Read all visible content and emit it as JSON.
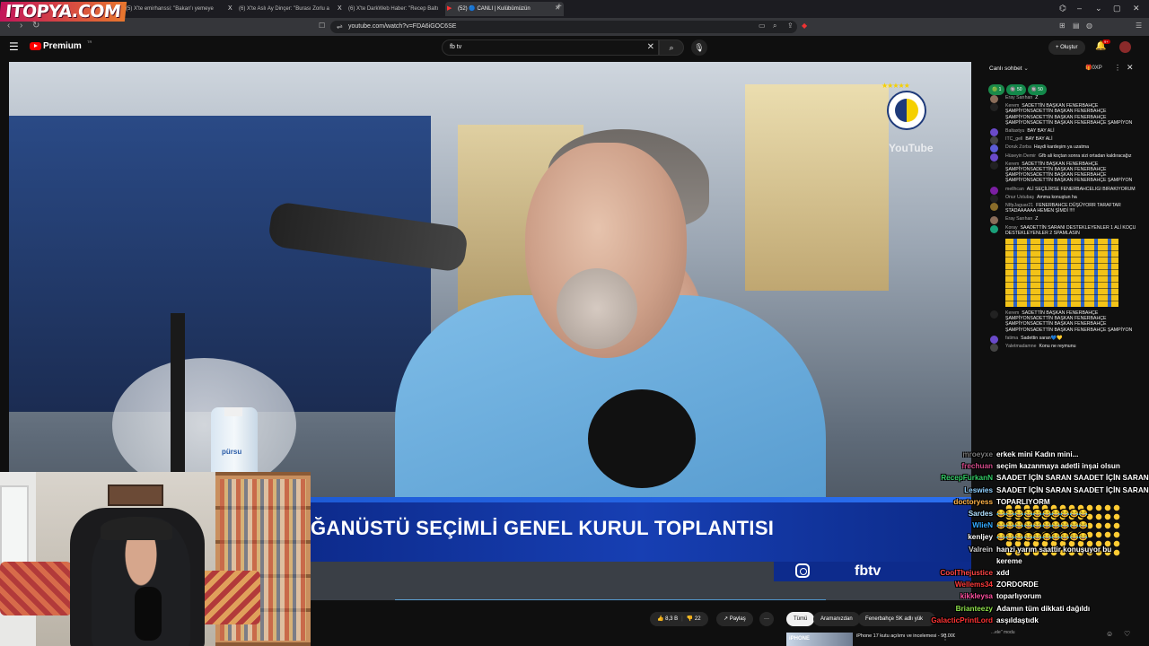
{
  "overlay_logo": "ITOPYA.COM",
  "tabs": [
    {
      "icon": "X",
      "label": "(5) X'te emirhanssi: \"Bakan'ı yemeye",
      "active": false
    },
    {
      "icon": "X",
      "label": "(6) X'te Aslı Ay Dinçer: \"Burası Zorlu a",
      "active": false
    },
    {
      "icon": "X",
      "label": "(6) X'te DarkWeb Haber: \"Recep Baltı",
      "active": false
    },
    {
      "icon": "▶",
      "label": "(52) 🔵 CANLI | Kulübümüzün",
      "active": true
    }
  ],
  "address": {
    "url": "youtube.com/watch?v=FDA6iGOC6SE"
  },
  "youtube": {
    "logo_text": "Premium",
    "logo_tm": "TR",
    "search_value": "fb tv",
    "create_label": "Oluştur",
    "notif_count": "9+"
  },
  "video": {
    "banner_text": "ĞANÜSTÜ SEÇİMLİ GENEL KURUL TOPLANTISI",
    "channel_brand": "fbtv",
    "watermark": "YouTube",
    "bottle_label": "pürsu"
  },
  "actions": {
    "likes": "8,3 B",
    "dislike_count": "22",
    "share": "Paylaş",
    "chips": [
      "Tümü",
      "Aramanızdan",
      "Fenerbahçe SK adlı yük"
    ],
    "reco_title": "iPhone 17 kutu açılımı ve incelemesi - 90.000 TL'ye değer",
    "reco_thumb_text": "iPHONE"
  },
  "chat": {
    "title": "Canlı sohbet",
    "header_right": "🎁0XP",
    "chips": [
      "🟢 1",
      "🔘 50",
      "🔘 50"
    ],
    "messages": [
      {
        "author": "Eray Sarıhan",
        "text": "Z",
        "color": "#8a6d5a"
      },
      {
        "author": "Kerem",
        "text": "SADETTİN BAŞKAN FENERBAHÇE ŞAMPİYONSADETTİN BAŞKAN FENERBAHÇE ŞAMPİYONSADETTİN BAŞKAN FENERBAHÇE ŞAMPİYONSADETTİN BAŞKAN FENERBAHÇE ŞAMPİYON",
        "color": "#222"
      },
      {
        "author": "Baltaxtyu",
        "text": "BAY BAY ALİ",
        "color": "#6a4ac9"
      },
      {
        "author": "ITC_gell",
        "text": "BAY BAY ALİ",
        "color": "#444"
      },
      {
        "author": "Doruk Zorba",
        "text": "Haydi kardeşim ya uzatma",
        "color": "#5c5cd6"
      },
      {
        "author": "Hüseyin Demir",
        "text": "Gfb ali koçtan sonra sizi ortadan kaldıracağız",
        "color": "#6a4ac9"
      },
      {
        "author": "Kerem",
        "text": "SADETTİN BAŞKAN FENERBAHÇE ŞAMPİYONSADETTİN BAŞKAN FENERBAHÇE ŞAMPİYONSADETTİN BAŞKAN FENERBAHÇE ŞAMPİYONSADETTİN BAŞKAN FENERBAHÇE ŞAMPİYON",
        "color": "#222"
      },
      {
        "author": "mellhcan",
        "text": "ALİ SEÇİLİRSE FENERBAHCELIGI BIRAKIYORUM",
        "color": "#7b1fa2"
      },
      {
        "author": "Onur Ustubaş",
        "text": "Amma konuştun ha",
        "color": "#222"
      },
      {
        "author": "NIfpJaguar21",
        "text": "FENERBAHCE DÜŞÜYORR TARAFTAR STADAAAAAA HEMEN ŞİMDİ !!!!",
        "color": "#8a6d2a"
      },
      {
        "author": "Eray Sarıhan",
        "text": "Z",
        "color": "#8a6d5a"
      },
      {
        "author": "Koray",
        "text": "SAADETTİN SARANI DESTEKLEYENLER 1 ALİ KOÇU DESTEKLEYENLER 2 SPAMLASIN",
        "color": "#1aa07a"
      }
    ],
    "messages2": [
      {
        "author": "Kerem",
        "text": "SADETTİN BAŞKAN FENERBAHÇE ŞAMPİYONSADETTİN BAŞKAN FENERBAHÇE ŞAMPİYONSADETTİN BAŞKAN FENERBAHÇE ŞAMPİYONSADETTİN BAŞKAN FENERBAHÇE ŞAMPİYON",
        "color": "#222"
      },
      {
        "author": "fatima",
        "text": "Sadettin saran💙💛",
        "color": "#6a4ac9"
      },
      {
        "author": "Yaletmadamne",
        "text": "Konu ne reymunu",
        "color": "#444"
      }
    ],
    "footer": "...ele\" modu"
  },
  "overlay_chat": [
    {
      "name": "mroeyxe",
      "msg": "erkek mini  Kadın mini...",
      "name_color": "#7a7a7a"
    },
    {
      "name": "frechuan",
      "msg": "seçim kazanmaya adetli inşai olsun",
      "name_color": "#d44a8a"
    },
    {
      "name": "RecepFurkanN",
      "msg": "SAADET İÇİN SARAN SAADET İÇİN SARAN",
      "name_color": "#33cc66"
    },
    {
      "name": "Leswies",
      "msg": "SAADET İÇİN SARAN SAADET İÇİN SARAN",
      "name_color": "#8fd0ff"
    },
    {
      "name": "doctoryess",
      "msg": "TOPARLIYORM",
      "name_color": "#ffb347"
    },
    {
      "name": "Sardes",
      "msg": "😂😂😂😂😂😂😂😂😂😂",
      "name_color": "#b0e0ff"
    },
    {
      "name": "WlieN",
      "msg": "😂😂😂😂😂😂😂😂😂😂",
      "name_color": "#33aaff"
    },
    {
      "name": "kenljey",
      "msg": "😂😂😂😂😂😂😂😂😂😂",
      "name_color": "#ffffff"
    },
    {
      "name": "Valrein",
      "msg": "hanzi yarım saattir konuşuyor bu",
      "name_color": "#cfcfcf"
    },
    {
      "name": "",
      "msg": "kereme",
      "name_color": "#ffffff"
    },
    {
      "name": "CoolThejustice",
      "msg": "xdd",
      "name_color": "#ff4444"
    },
    {
      "name": "Wellems34",
      "msg": "ZORDORDE",
      "name_color": "#ff3a3a"
    },
    {
      "name": "kikkleysa",
      "msg": "toparlıyorum",
      "name_color": "#ff4fa0"
    },
    {
      "name": "Brianteezy",
      "msg": "Adamın tüm dikkati dağıldı",
      "name_color": "#8ee04a"
    },
    {
      "name": "GalacticPrintLord",
      "msg": "asşıldaştıdk",
      "name_color": "#ff3333"
    }
  ]
}
